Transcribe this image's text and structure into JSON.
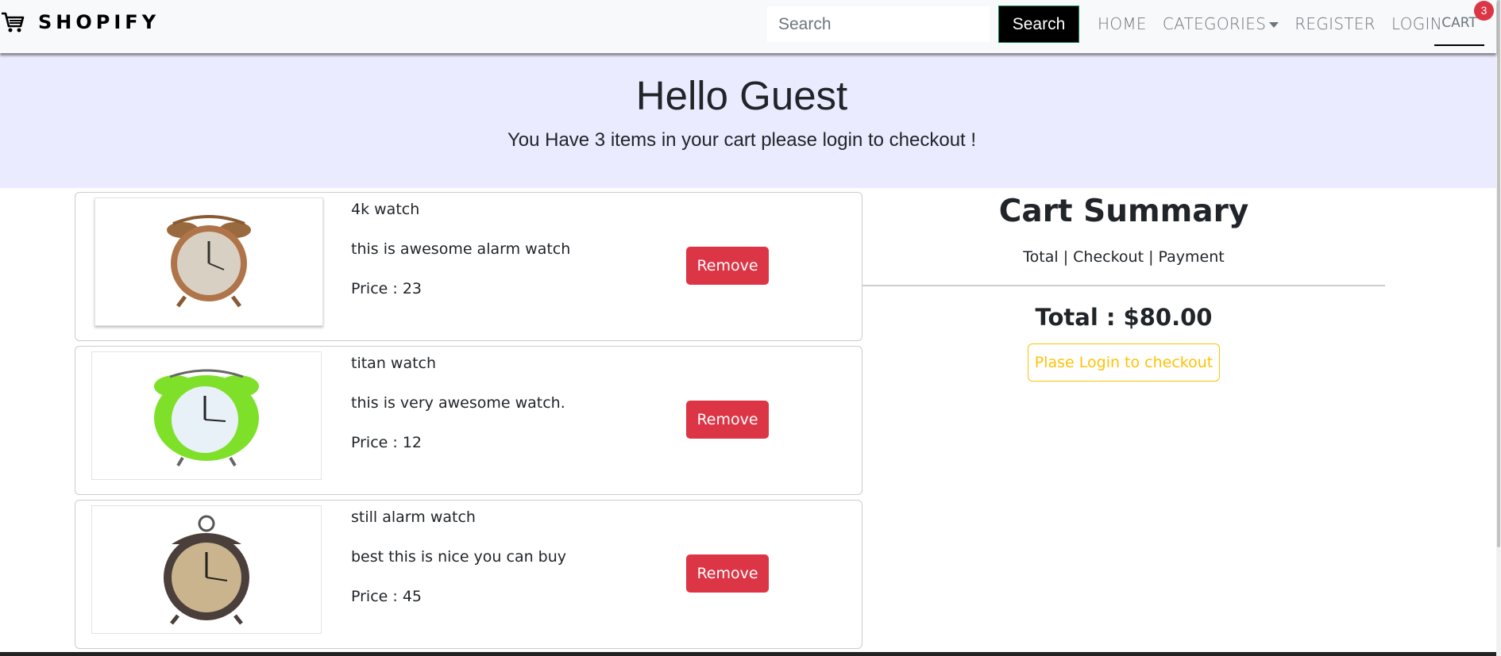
{
  "navbar": {
    "brand": "SHOPIFY",
    "search_placeholder": "Search",
    "search_button": "Search",
    "links": [
      "HOME",
      "CATEGORIES",
      "REGISTER",
      "LOGIN"
    ],
    "cart_label": "CART",
    "cart_count": "3"
  },
  "hero": {
    "greeting": "Hello Guest",
    "message": "You Have 3 items in your cart please login to checkout !"
  },
  "cart_items": [
    {
      "name": "4k watch",
      "description": "this is awesome alarm watch",
      "price": "Price : 23",
      "remove_label": "Remove",
      "clock_color": "#b0744a"
    },
    {
      "name": "titan watch",
      "description": "this is very awesome watch.",
      "price": "Price : 12",
      "remove_label": "Remove",
      "clock_color": "#7fe02a"
    },
    {
      "name": "still alarm watch",
      "description": "best this is nice you can buy",
      "price": "Price : 45",
      "remove_label": "Remove",
      "clock_color": "#4a3f3a"
    }
  ],
  "summary": {
    "title": "Cart Summary",
    "subtitle": "Total | Checkout | Payment",
    "total": "Total : $80.00",
    "login_button": "Plase Login to checkout"
  },
  "colors": {
    "hero_bg": "#ebebff",
    "remove_button": "#dc3545",
    "login_button": "#ffc107",
    "badge": "#dc3545"
  }
}
